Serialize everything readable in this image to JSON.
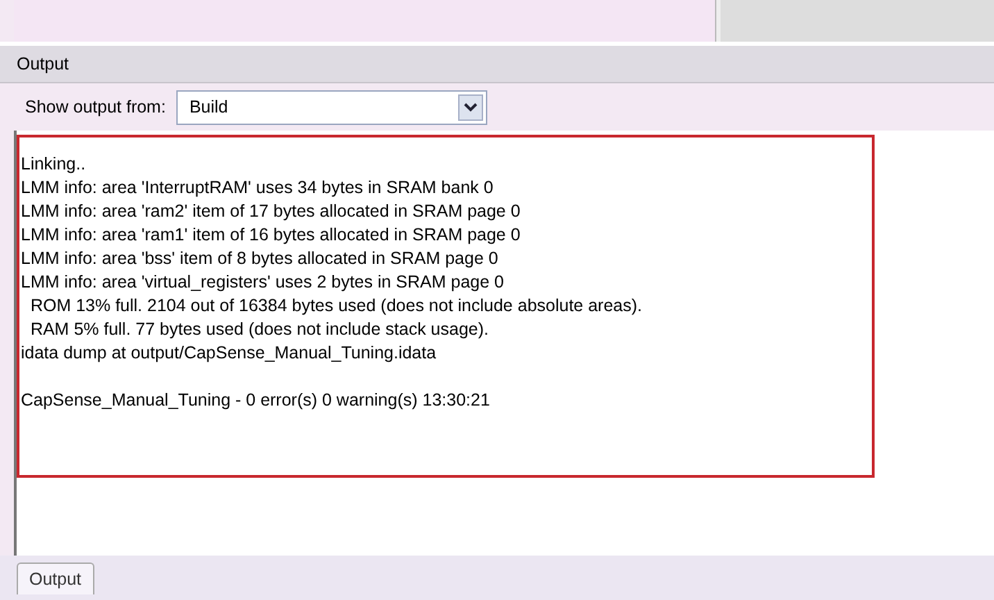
{
  "panel": {
    "title": "Output"
  },
  "toolbar": {
    "label": "Show output from:",
    "dropdown": {
      "value": "Build"
    }
  },
  "output_lines": [
    "Linking..",
    "LMM info: area 'InterruptRAM' uses 34 bytes in SRAM bank 0",
    "LMM info: area 'ram2' item of 17 bytes allocated in SRAM page 0",
    "LMM info: area 'ram1' item of 16 bytes allocated in SRAM page 0",
    "LMM info: area 'bss' item of 8 bytes allocated in SRAM page 0",
    "LMM info: area 'virtual_registers' uses 2 bytes in SRAM page 0",
    "  ROM 13% full. 2104 out of 16384 bytes used (does not include absolute areas).",
    "  RAM 5% full. 77 bytes used (does not include stack usage).",
    "idata dump at output/CapSense_Manual_Tuning.idata"
  ],
  "summary_line": "CapSense_Manual_Tuning - 0 error(s) 0 warning(s) 13:30:21",
  "tabs": [
    {
      "label": "Output",
      "selected": true
    }
  ]
}
